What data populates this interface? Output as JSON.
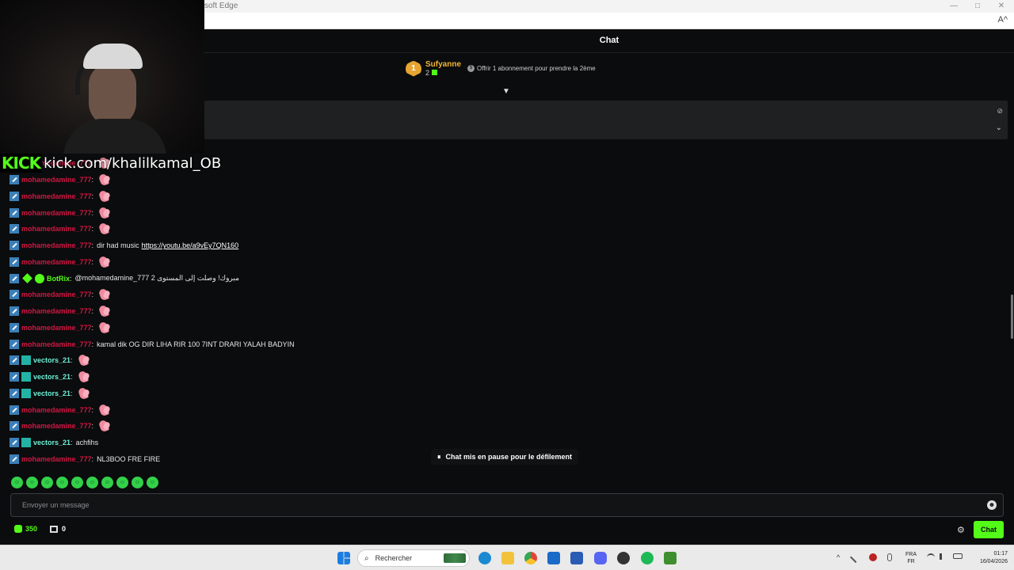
{
  "browser": {
    "title": "soft Edge",
    "min": "—",
    "max": "□",
    "close": "✕",
    "read_aloud": "A^"
  },
  "overlay": {
    "brand_logo": "KICK",
    "channel_url": "kick.com/khalilkamal_OB"
  },
  "chat": {
    "header_title": "Chat",
    "leaderboard": {
      "rank": "1",
      "name": "Sufyanne",
      "count": "2",
      "offer": "Offrir 1 abonnement pour prendre la 2ème"
    },
    "expand_icon": "▼",
    "pinned": {
      "hide_icon": "⊘",
      "chevron": "⌄"
    },
    "messages": [
      {
        "user": "mohamedamine_777",
        "color": "red",
        "badge": "mod",
        "text": "",
        "emote": true
      },
      {
        "user": "mohamedamine_777",
        "color": "red",
        "badge": "mod",
        "text": "",
        "emote": true
      },
      {
        "user": "mohamedamine_777",
        "color": "red",
        "badge": "mod",
        "text": "",
        "emote": true
      },
      {
        "user": "mohamedamine_777",
        "color": "red",
        "badge": "mod",
        "text": "",
        "emote": true
      },
      {
        "user": "mohamedamine_777",
        "color": "red",
        "badge": "mod",
        "text": "",
        "emote": true
      },
      {
        "user": "mohamedamine_777",
        "color": "red",
        "badge": "mod",
        "text": "dir had music",
        "link": "https://youtu.be/a9vEy7QN160",
        "emote": false
      },
      {
        "user": "mohamedamine_777",
        "color": "red",
        "badge": "mod",
        "text": "",
        "emote": true
      },
      {
        "user": "BotRix",
        "color": "green",
        "badge": "bot",
        "text": "@mohamedamine_777 مبروك! وصلت إلى المستوى 2",
        "emote": false
      },
      {
        "user": "mohamedamine_777",
        "color": "red",
        "badge": "mod",
        "text": "",
        "emote": true
      },
      {
        "user": "mohamedamine_777",
        "color": "red",
        "badge": "mod",
        "text": "",
        "emote": true
      },
      {
        "user": "mohamedamine_777",
        "color": "red",
        "badge": "mod",
        "text": "",
        "emote": true
      },
      {
        "user": "mohamedamine_777",
        "color": "red",
        "badge": "mod",
        "text": "kamal dik OG DIR LIHA RIR 100 7INT DRARI YALAH BADYIN",
        "emote": false
      },
      {
        "user": "vectors_21",
        "color": "cyan",
        "badge": "sub",
        "text": "",
        "emote": true
      },
      {
        "user": "vectors_21",
        "color": "cyan",
        "badge": "sub",
        "text": "",
        "emote": true
      },
      {
        "user": "vectors_21",
        "color": "cyan",
        "badge": "sub",
        "text": "",
        "emote": true
      },
      {
        "user": "mohamedamine_777",
        "color": "red",
        "badge": "mod",
        "text": "",
        "emote": true
      },
      {
        "user": "mohamedamine_777",
        "color": "red",
        "badge": "mod",
        "text": "",
        "emote": true
      },
      {
        "user": "vectors_21",
        "color": "cyan",
        "badge": "sub",
        "text": "achfihs",
        "emote": false
      },
      {
        "user": "mohamedamine_777",
        "color": "red",
        "badge": "mod",
        "text": "NL3BOO FRE FIRE",
        "emote": false
      }
    ],
    "separator": ":",
    "quick_emotes": [
      "☺",
      "☺",
      "☺",
      "☺",
      "☺",
      "☺",
      "☺",
      "☺",
      "☺",
      "☺"
    ],
    "paused_icon": "⏸",
    "paused_text": "Chat mis en pause pour le défilement",
    "input_placeholder": "Envoyer un message",
    "emoji_icon": "☻",
    "points": "350",
    "boxes": "0",
    "settings_icon": "⚙",
    "send_label": "Chat"
  },
  "taskbar": {
    "search_placeholder": "Rechercher",
    "search_icon": "⌕",
    "tray_up": "^",
    "lang_top": "FRA",
    "lang_bottom": "FR",
    "time": "01:17",
    "date": "16/04/2026"
  },
  "colors": {
    "accent": "#53fc18",
    "mod_user": "#d11744",
    "sub_user": "#6ff0d8",
    "leader_gold": "#f2b535"
  }
}
